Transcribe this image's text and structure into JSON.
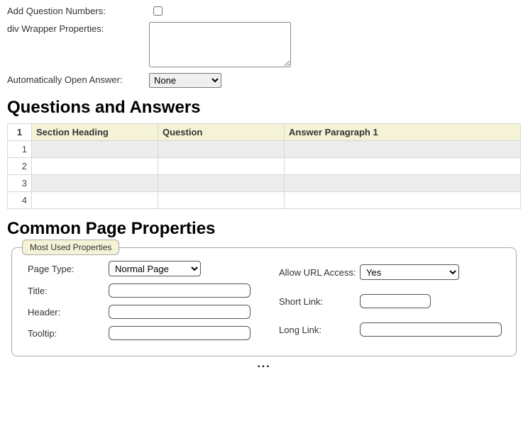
{
  "topForm": {
    "addQuestionNumbers": {
      "label": "Add Question Numbers:",
      "checked": false
    },
    "divWrapperProps": {
      "label": "div Wrapper Properties:",
      "value": ""
    },
    "autoOpenAnswer": {
      "label": "Automatically Open Answer:",
      "selected": "None"
    }
  },
  "qaHeading": "Questions and Answers",
  "qaTable": {
    "cornerLabel": "1",
    "headers": [
      "Section Heading",
      "Question",
      "Answer Paragraph 1"
    ],
    "rows": [
      {
        "num": "1",
        "sectionHeading": "",
        "question": "",
        "answer": ""
      },
      {
        "num": "2",
        "sectionHeading": "",
        "question": "",
        "answer": ""
      },
      {
        "num": "3",
        "sectionHeading": "",
        "question": "",
        "answer": ""
      },
      {
        "num": "4",
        "sectionHeading": "",
        "question": "",
        "answer": ""
      }
    ]
  },
  "commonHeading": "Common Page Properties",
  "mostUsed": {
    "legend": "Most Used Properties",
    "pageType": {
      "label": "Page Type:",
      "selected": "Normal Page"
    },
    "title": {
      "label": "Title:",
      "value": ""
    },
    "header": {
      "label": "Header:",
      "value": ""
    },
    "tooltip": {
      "label": "Tooltip:",
      "value": ""
    },
    "allowUrl": {
      "label": "Allow URL Access:",
      "selected": "Yes"
    },
    "shortLink": {
      "label": "Short Link:",
      "value": ""
    },
    "longLink": {
      "label": "Long Link:",
      "value": ""
    }
  },
  "ellipsis": "..."
}
